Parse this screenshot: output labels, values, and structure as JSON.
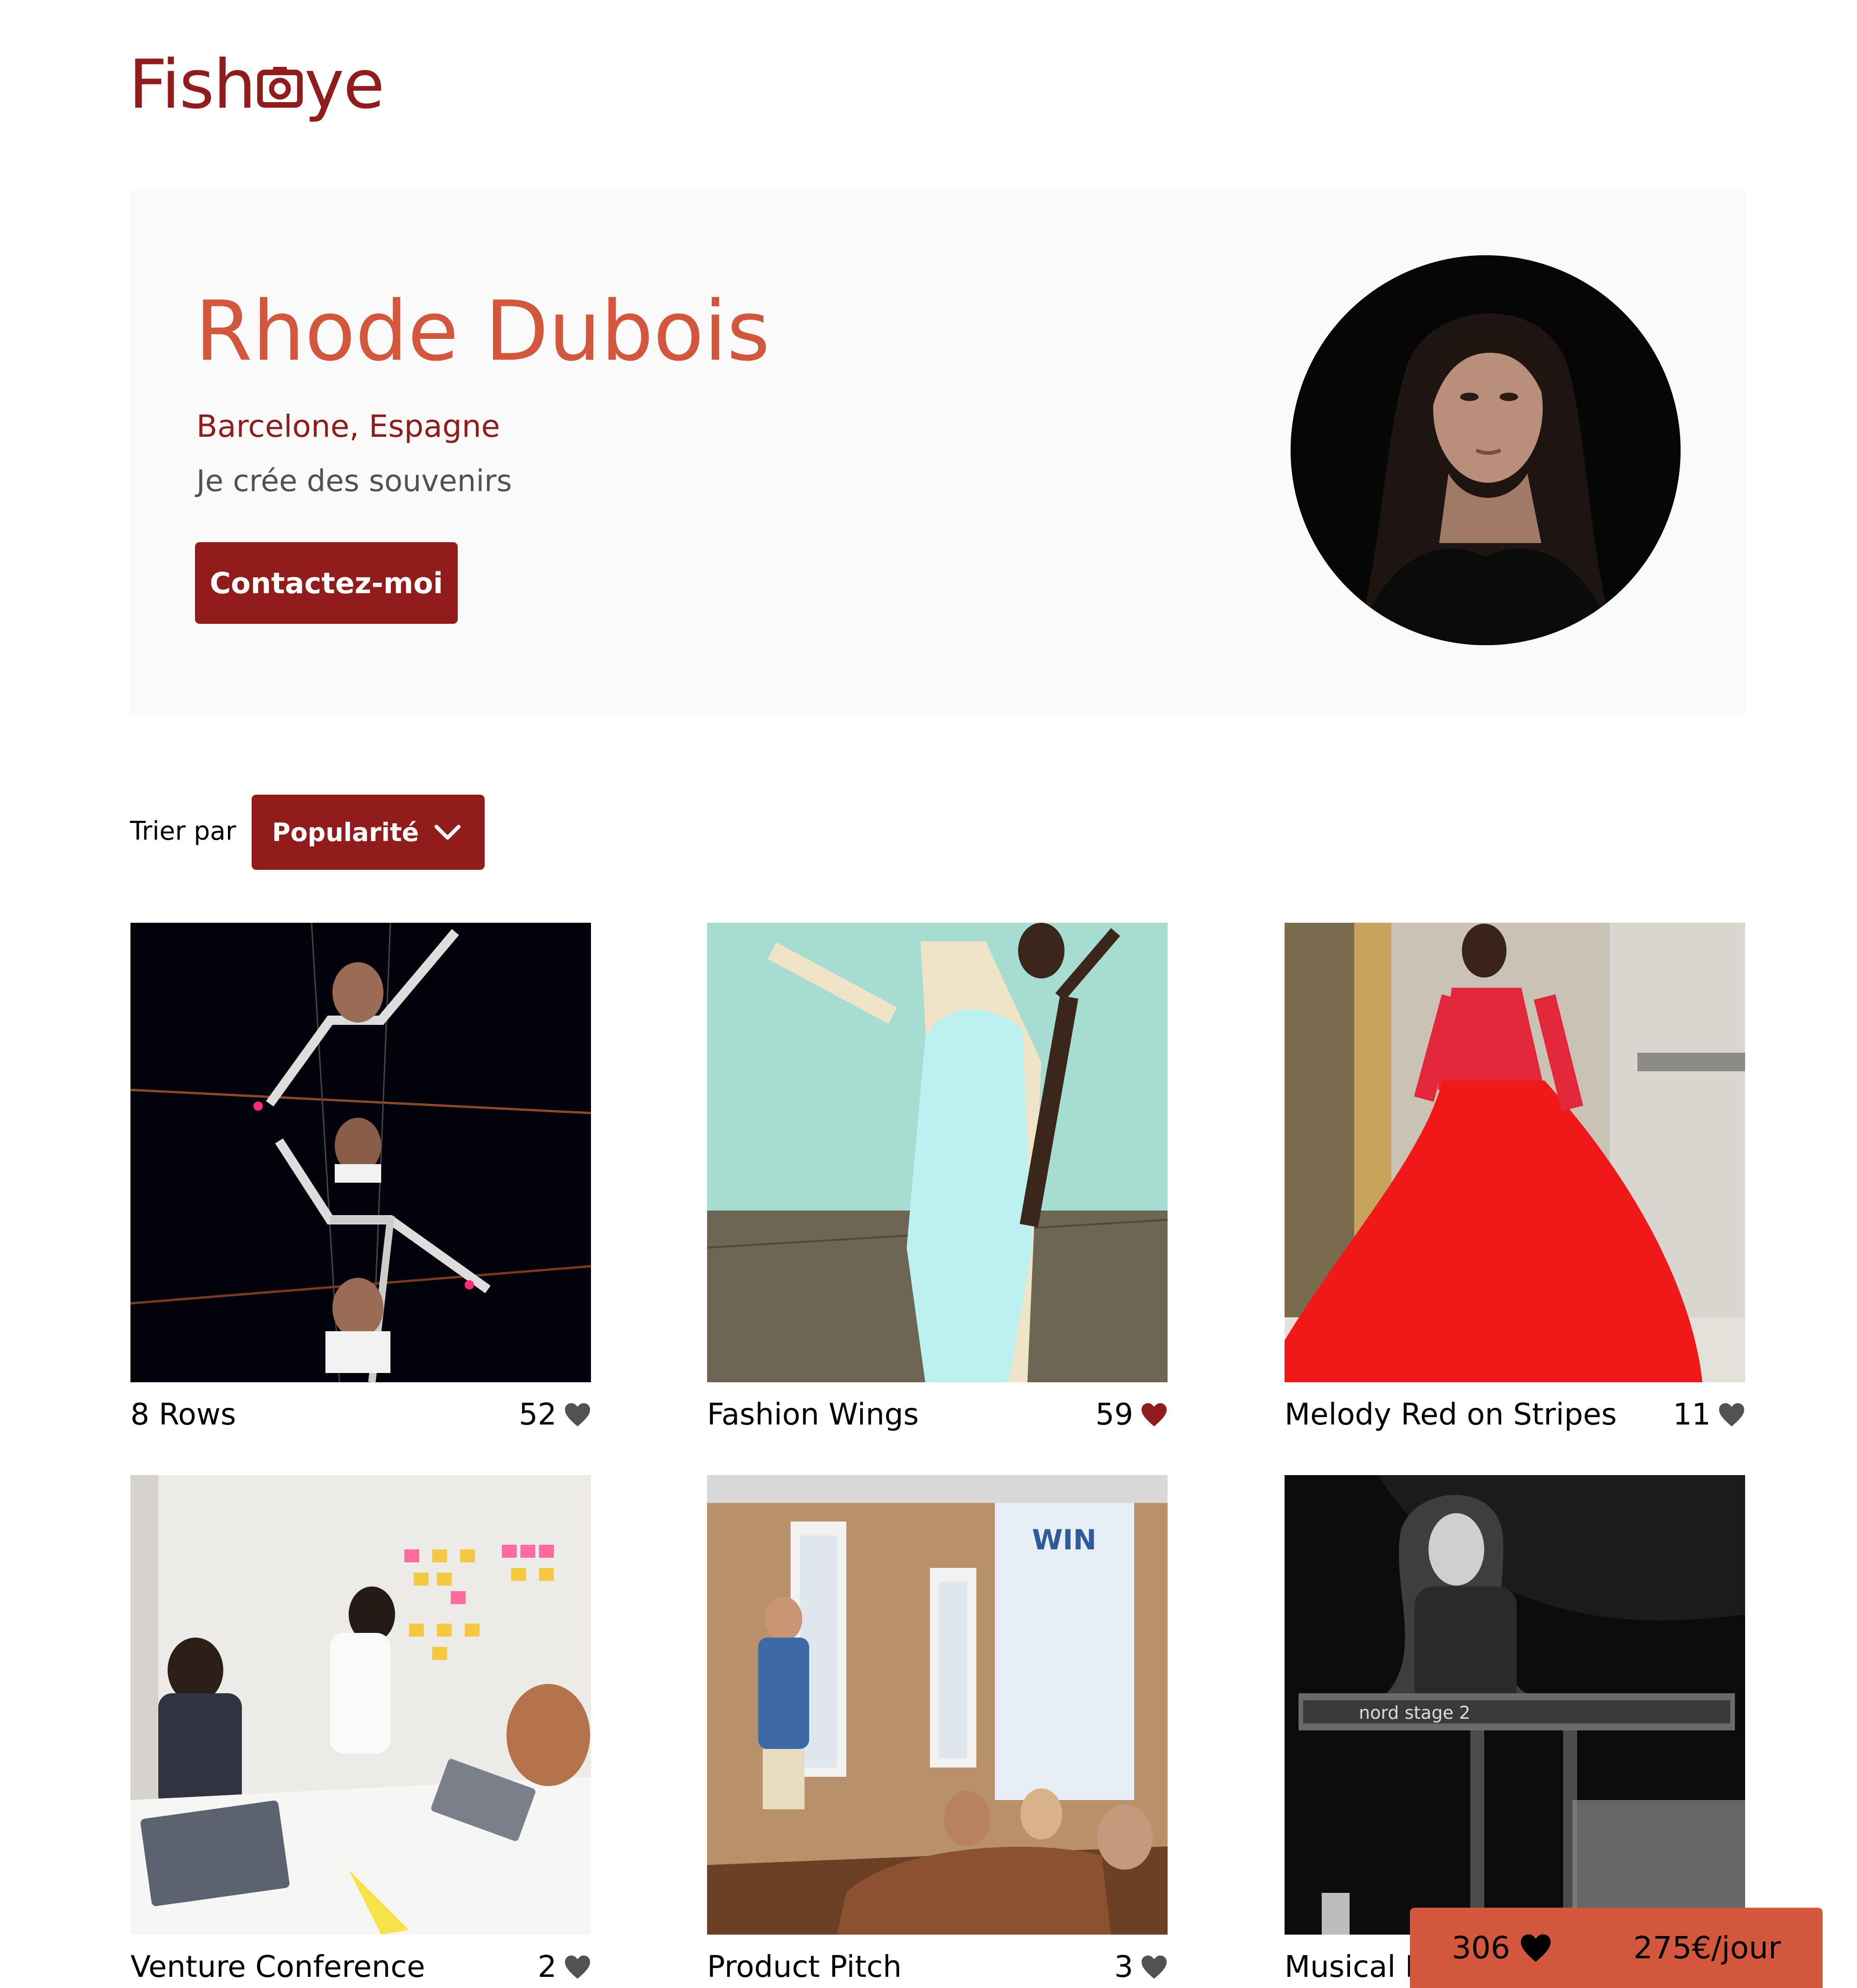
{
  "brand": {
    "logo_left": "Fish",
    "logo_right": "ye"
  },
  "photographer": {
    "name": "Rhode Dubois",
    "location": "Barcelone, Espagne",
    "tagline": "Je crée des souvenirs",
    "contact_label": "Contactez-moi"
  },
  "sort": {
    "label": "Trier par",
    "selected": "Popularité"
  },
  "media": [
    {
      "title": "8 Rows",
      "likes": "52"
    },
    {
      "title": "Fashion Wings",
      "likes": "59",
      "liked": true
    },
    {
      "title": "Melody Red on Stripes",
      "likes": "11"
    },
    {
      "title": "Venture Conference",
      "likes": "2"
    },
    {
      "title": "Product Pitch",
      "likes": "3"
    },
    {
      "title": "Musical F",
      "likes": ""
    }
  ],
  "summary": {
    "total_likes": "306",
    "price": "275€/jour"
  },
  "colors": {
    "primary": "#901C1C",
    "secondary": "#D3573C",
    "banner_bg": "#FAFAFA",
    "liked_heart": "#901C1C",
    "heart": "#525252"
  },
  "keyboard_text": "nord stage 2"
}
